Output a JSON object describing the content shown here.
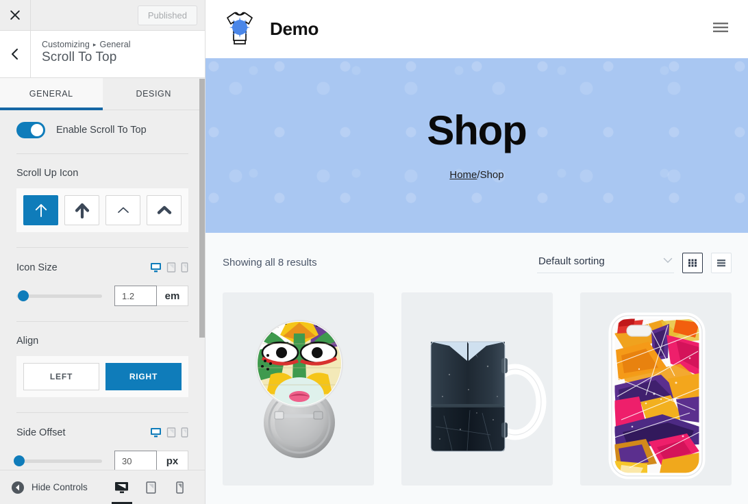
{
  "customizer": {
    "topbar": {
      "close_icon": "close-icon",
      "publish_label": "Published"
    },
    "header": {
      "back_icon": "chevron-left-icon",
      "breadcrumb_root": "Customizing",
      "breadcrumb_sep": "▸",
      "breadcrumb_parent": "General",
      "panel_title": "Scroll To Top"
    },
    "tabs": [
      {
        "label": "GENERAL",
        "active": true
      },
      {
        "label": "DESIGN",
        "active": false
      }
    ],
    "controls": {
      "enable_toggle": {
        "label": "Enable Scroll To Top",
        "on": true
      },
      "scroll_up_icon": {
        "label": "Scroll Up Icon",
        "options": [
          {
            "name": "arrow-up-thin-icon",
            "selected": true
          },
          {
            "name": "arrow-up-bold-icon",
            "selected": false
          },
          {
            "name": "chevron-up-thin-icon",
            "selected": false
          },
          {
            "name": "chevron-up-bold-icon",
            "selected": false
          }
        ]
      },
      "icon_size": {
        "label": "Icon Size",
        "value": "1.2",
        "unit": "em",
        "slider_percent": 8,
        "devices": [
          {
            "name": "desktop-icon",
            "active": true
          },
          {
            "name": "tablet-icon",
            "active": false
          },
          {
            "name": "mobile-icon",
            "active": false
          }
        ]
      },
      "align": {
        "label": "Align",
        "options": [
          {
            "label": "LEFT",
            "selected": false
          },
          {
            "label": "RIGHT",
            "selected": true
          }
        ]
      },
      "side_offset": {
        "label": "Side Offset",
        "value": "30",
        "unit": "px",
        "slider_percent": 3,
        "devices": [
          {
            "name": "desktop-icon",
            "active": true
          },
          {
            "name": "tablet-icon",
            "active": false
          },
          {
            "name": "mobile-icon",
            "active": false
          }
        ]
      }
    },
    "footer": {
      "hide_controls_label": "Hide Controls",
      "devices": [
        {
          "name": "desktop-icon",
          "active": true
        },
        {
          "name": "tablet-icon",
          "active": false
        },
        {
          "name": "mobile-icon",
          "active": false
        }
      ]
    }
  },
  "preview": {
    "site_header": {
      "logo_icon": "tshirt-splat-logo-icon",
      "brand_name": "Demo",
      "menu_icon": "hamburger-menu-icon"
    },
    "hero": {
      "title": "Shop",
      "breadcrumb_home": "Home",
      "breadcrumb_separator": "/",
      "breadcrumb_current": "Shop",
      "background_color": "#a9c7f2"
    },
    "shop": {
      "results_text": "Showing all 8 results",
      "sorting_value": "Default sorting",
      "grid_view_icon": "grid-view-icon",
      "list_view_icon": "list-view-icon",
      "grid_view_active": true,
      "products": [
        {
          "name": "pin-badge-face-art-product"
        },
        {
          "name": "dark-ceramic-mug-product"
        },
        {
          "name": "abstract-paint-phone-case-product"
        }
      ]
    }
  },
  "colors": {
    "accent_blue": "#0f7cba",
    "tab_underline": "#1667a5",
    "sidebar_bg": "#eeeeee",
    "hero_blue": "#a9c7f2",
    "shop_bg": "#f8fafb"
  }
}
